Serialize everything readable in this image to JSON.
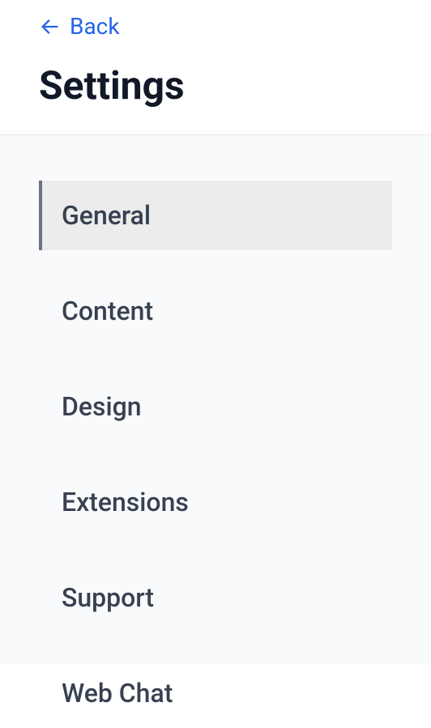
{
  "header": {
    "back_label": "Back",
    "title": "Settings"
  },
  "nav": {
    "items": [
      {
        "label": "General",
        "active": true
      },
      {
        "label": "Content",
        "active": false
      },
      {
        "label": "Design",
        "active": false
      },
      {
        "label": "Extensions",
        "active": false
      },
      {
        "label": "Support",
        "active": false
      },
      {
        "label": "Web Chat",
        "active": false
      }
    ]
  }
}
